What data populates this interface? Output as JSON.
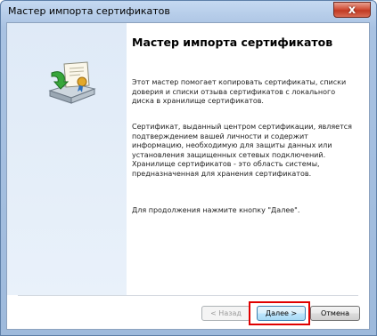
{
  "window": {
    "title": "Мастер импорта сертификатов",
    "close_label": "x"
  },
  "icons": {
    "close": "close-icon",
    "wizard_art": "certificate-import-icon"
  },
  "content": {
    "heading": "Мастер импорта сертификатов",
    "paragraph1": "Этот мастер помогает копировать сертификаты, списки доверия и списки отзыва сертификатов с локального диска в хранилище сертификатов.",
    "paragraph2": "Сертификат, выданный центром сертификации, является подтверждением вашей личности и содержит информацию, необходимую для защиты данных или установления защищенных сетевых подключений. Хранилище сертификатов - это область системы, предназначенная для хранения сертификатов.",
    "paragraph3": "Для продолжения нажмите кнопку \"Далее\"."
  },
  "buttons": {
    "back": "< Назад",
    "next": "Далее >",
    "cancel": "Отмена"
  },
  "colors": {
    "highlight": "#e00000",
    "titlebar": "#a9c2e2",
    "close": "#c13a22"
  }
}
